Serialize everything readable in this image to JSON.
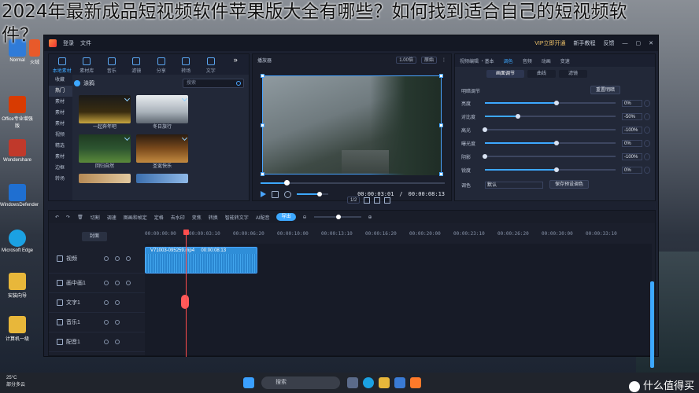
{
  "overlay_title": {
    "line1": "2024年最新成品短视频软件苹果版大全有哪些？如何找到适合自己的短视频软",
    "line2": "件？"
  },
  "desktop": {
    "icons": [
      "Normal",
      "火绒",
      "Office专业增强版",
      "Wondershare",
      "WindowsDefender",
      "Microsoft Edge",
      "安装向导",
      "计算机一级"
    ]
  },
  "app": {
    "titlebar": {
      "login": "登录",
      "file": "文件",
      "vip": "VIP立即开通",
      "newbie": "新手教程",
      "feedback": "反馈"
    },
    "media": {
      "tabs": [
        "本地素材",
        "素材库",
        "音乐",
        "滤镜",
        "分享",
        "转场",
        "文字"
      ],
      "side": [
        "收藏",
        "热门",
        "素材",
        "素材",
        "素材",
        "视频",
        "精选",
        "素材",
        "边框",
        "转场"
      ],
      "tag": "涂鸦",
      "search_placeholder": "搜索",
      "thumbs": [
        {
          "cap": "一起奔年吧"
        },
        {
          "cap": "冬日旅行"
        },
        {
          "cap": "回归自然"
        },
        {
          "cap": "圣诞快乐"
        },
        {
          "cap": ""
        },
        {
          "cap": ""
        }
      ]
    },
    "preview": {
      "label": "播放器",
      "zoom": "1.00倍",
      "mode": "原始",
      "current": "00:00:03:01",
      "duration": "00:00:08:13",
      "ratio": "1/2"
    },
    "props": {
      "tabs": [
        "视频编辑 ・基本",
        "调色",
        "音频",
        "动画",
        "变速"
      ],
      "subtabs": [
        "画面调节",
        "曲线",
        "滤镜"
      ],
      "section": "明暗调节",
      "reset": "重置明暗",
      "sliders": [
        {
          "label": "亮度",
          "value": "0%",
          "pos": 0.55
        },
        {
          "label": "对比度",
          "value": "-50%",
          "pos": 0.25
        },
        {
          "label": "高光",
          "value": "-100%",
          "pos": 0.0
        },
        {
          "label": "曝光度",
          "value": "0%",
          "pos": 0.55
        },
        {
          "label": "阴影",
          "value": "-100%",
          "pos": 0.0
        },
        {
          "label": "锐度",
          "value": "0%",
          "pos": 0.55
        }
      ],
      "tone_label": "调色",
      "tone_value": "默认",
      "save": "保存预设调色"
    },
    "timeline": {
      "tools": [
        "切割",
        "调速",
        "图画和帧定",
        "定格",
        "去水印",
        "变焦",
        "转换",
        "智能转文字",
        "AI配音",
        "导出"
      ],
      "cover": "封面",
      "ruler": [
        "00:00:00:00",
        "00:00:03:10",
        "00:00:06:20",
        "00:00:10:00",
        "00:00:13:10",
        "00:00:16:20",
        "00:00:20:00",
        "00:00:23:10",
        "00:00:26:20",
        "00:00:30:00",
        "00:00:33:10"
      ],
      "tracks": [
        "视频",
        "画中画1",
        "文字1",
        "音乐1",
        "配音1"
      ],
      "clip": {
        "name": "V71003-095259.mp4",
        "dur": "00:00:08:13"
      }
    }
  },
  "taskbar": {
    "temp": "25°C",
    "weather": "部分多云",
    "search": "搜索"
  },
  "watermark": "什么值得买",
  "colors": {
    "accent": "#3da8ff",
    "playhead": "#ff4d4d"
  }
}
